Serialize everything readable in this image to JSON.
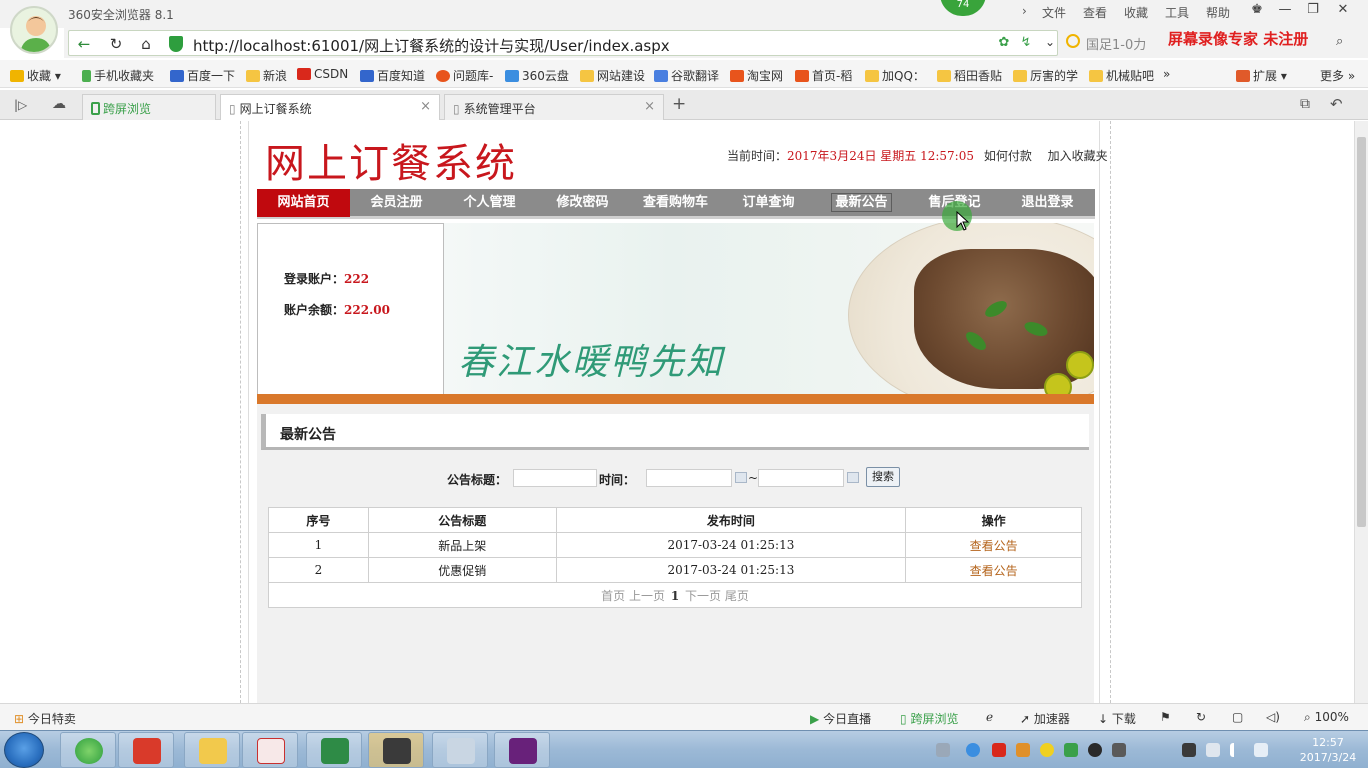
{
  "browser": {
    "app_title": "360安全浏览器 8.1",
    "badge": "74",
    "menu": [
      "文件",
      "查看",
      "收藏",
      "工具",
      "帮助"
    ],
    "url": "http://localhost:61001/网上订餐系统的设计与实现/User/index.aspx",
    "search_text": "国足1-0力",
    "recorder_text": "屏幕录像专家  未注册"
  },
  "bookmarks": [
    {
      "label": "收藏",
      "color": "#f0b400"
    },
    {
      "label": "手机收藏夹",
      "color": "#4caf50"
    },
    {
      "label": "百度一下",
      "color": "#3366cc"
    },
    {
      "label": "新浪",
      "color": "#f5c542"
    },
    {
      "label": "CSDN",
      "color": "#d9281b"
    },
    {
      "label": "百度知道",
      "color": "#3366cc"
    },
    {
      "label": "问题库-",
      "color": "#e8541c"
    },
    {
      "label": "360云盘",
      "color": "#3b8ee0"
    },
    {
      "label": "网站建设",
      "color": "#f5c542"
    },
    {
      "label": "谷歌翻译",
      "color": "#4a7fe0"
    },
    {
      "label": "淘宝网",
      "color": "#e8541c"
    },
    {
      "label": "首页-稻",
      "color": "#e8541c"
    },
    {
      "label": "加QQ：",
      "color": "#f5c542"
    },
    {
      "label": "稻田香贴",
      "color": "#f5c542"
    },
    {
      "label": "厉害的学",
      "color": "#f5c542"
    },
    {
      "label": "机械贴吧",
      "color": "#f5c542"
    }
  ],
  "bookmarks_right": {
    "ext": "扩展",
    "more": "更多"
  },
  "tabs": [
    {
      "label": "跨屏浏览"
    },
    {
      "label": "网上订餐系统"
    },
    {
      "label": "系统管理平台"
    }
  ],
  "site": {
    "logo": "网上订餐系统",
    "time_label": "当前时间：",
    "time_value": "2017年3月24日 星期五 12:57:05",
    "pay_link": "如何付款",
    "fav_link": "加入收藏夹",
    "nav": [
      "网站首页",
      "会员注册",
      "个人管理",
      "修改密码",
      "查看购物车",
      "订单查询",
      "最新公告",
      "售后登记",
      "退出登录"
    ],
    "account_label": "登录账户：",
    "account_value": "222",
    "balance_label": "账户余额：",
    "balance_value": "222.00",
    "banner_text": "春江水暖鸭先知",
    "section_title": "最新公告",
    "search_title_label": "公告标题：",
    "search_time_label": "时间：",
    "search_sep": "~",
    "search_button": "搜索",
    "table_headers": [
      "序号",
      "公告标题",
      "发布时间",
      "操作"
    ],
    "rows": [
      {
        "no": "1",
        "title": "新品上架",
        "time": "2017-03-24 01:25:13",
        "action": "查看公告"
      },
      {
        "no": "2",
        "title": "优惠促销",
        "time": "2017-03-24 01:25:13",
        "action": "查看公告"
      }
    ],
    "pager": {
      "first": "首页",
      "prev": "上一页",
      "current": "1",
      "next": "下一页",
      "last": "尾页"
    }
  },
  "statusbar": {
    "left": "今日特卖",
    "live": "今日直播",
    "cross": "跨屏浏览",
    "accel": "加速器",
    "download": "下载",
    "zoom": "100%"
  },
  "taskbar": {
    "time": "12:57",
    "date": "2017/3/24"
  },
  "colors": {
    "brand_red": "#c8171d",
    "nav_gray": "#8b8b8b",
    "accent_orange": "#d9782b",
    "link_brown": "#b5651d"
  }
}
